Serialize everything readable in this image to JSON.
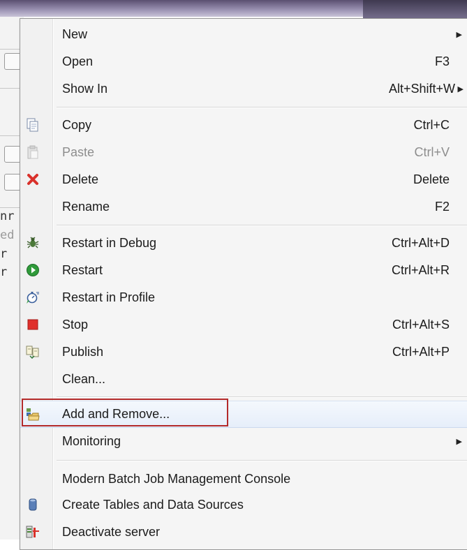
{
  "menu": {
    "items": [
      {
        "label": "New",
        "shortcut": "",
        "submenu": true,
        "icon": "",
        "disabled": false
      },
      {
        "label": "Open",
        "shortcut": "F3",
        "submenu": false,
        "icon": "",
        "disabled": false
      },
      {
        "label": "Show In",
        "shortcut": "Alt+Shift+W",
        "submenu": true,
        "icon": "",
        "disabled": false
      },
      {
        "label": "Copy",
        "shortcut": "Ctrl+C",
        "submenu": false,
        "icon": "copy-icon",
        "disabled": false
      },
      {
        "label": "Paste",
        "shortcut": "Ctrl+V",
        "submenu": false,
        "icon": "paste-icon",
        "disabled": true
      },
      {
        "label": "Delete",
        "shortcut": "Delete",
        "submenu": false,
        "icon": "delete-icon",
        "disabled": false
      },
      {
        "label": "Rename",
        "shortcut": "F2",
        "submenu": false,
        "icon": "",
        "disabled": false
      },
      {
        "label": "Restart in Debug",
        "shortcut": "Ctrl+Alt+D",
        "submenu": false,
        "icon": "debug-bug-icon",
        "disabled": false
      },
      {
        "label": "Restart",
        "shortcut": "Ctrl+Alt+R",
        "submenu": false,
        "icon": "restart-play-icon",
        "disabled": false
      },
      {
        "label": "Restart in Profile",
        "shortcut": "",
        "submenu": false,
        "icon": "profile-stopwatch-icon",
        "disabled": false
      },
      {
        "label": "Stop",
        "shortcut": "Ctrl+Alt+S",
        "submenu": false,
        "icon": "stop-icon",
        "disabled": false
      },
      {
        "label": "Publish",
        "shortcut": "Ctrl+Alt+P",
        "submenu": false,
        "icon": "publish-icon",
        "disabled": false
      },
      {
        "label": "Clean...",
        "shortcut": "",
        "submenu": false,
        "icon": "",
        "disabled": false
      },
      {
        "label": "Add and Remove...",
        "shortcut": "",
        "submenu": false,
        "icon": "add-remove-folder-icon",
        "disabled": false
      },
      {
        "label": "Monitoring",
        "shortcut": "",
        "submenu": true,
        "icon": "",
        "disabled": false
      },
      {
        "label": "Modern Batch Job Management Console",
        "shortcut": "",
        "submenu": false,
        "icon": "",
        "disabled": false
      },
      {
        "label": "Create Tables and Data Sources",
        "shortcut": "",
        "submenu": false,
        "icon": "database-icon",
        "disabled": false
      },
      {
        "label": "Deactivate server",
        "shortcut": "",
        "submenu": false,
        "icon": "deactivate-server-icon",
        "disabled": false
      }
    ],
    "highlighted_item": "Add and Remove..."
  },
  "background": {
    "left_fragments": [
      "nr",
      "ed",
      "r",
      "r"
    ]
  },
  "colors": {
    "highlight_border": "#b32a2a",
    "delete_red": "#d9312b",
    "restart_green": "#2f9a3a",
    "stop_red": "#e0302c"
  }
}
